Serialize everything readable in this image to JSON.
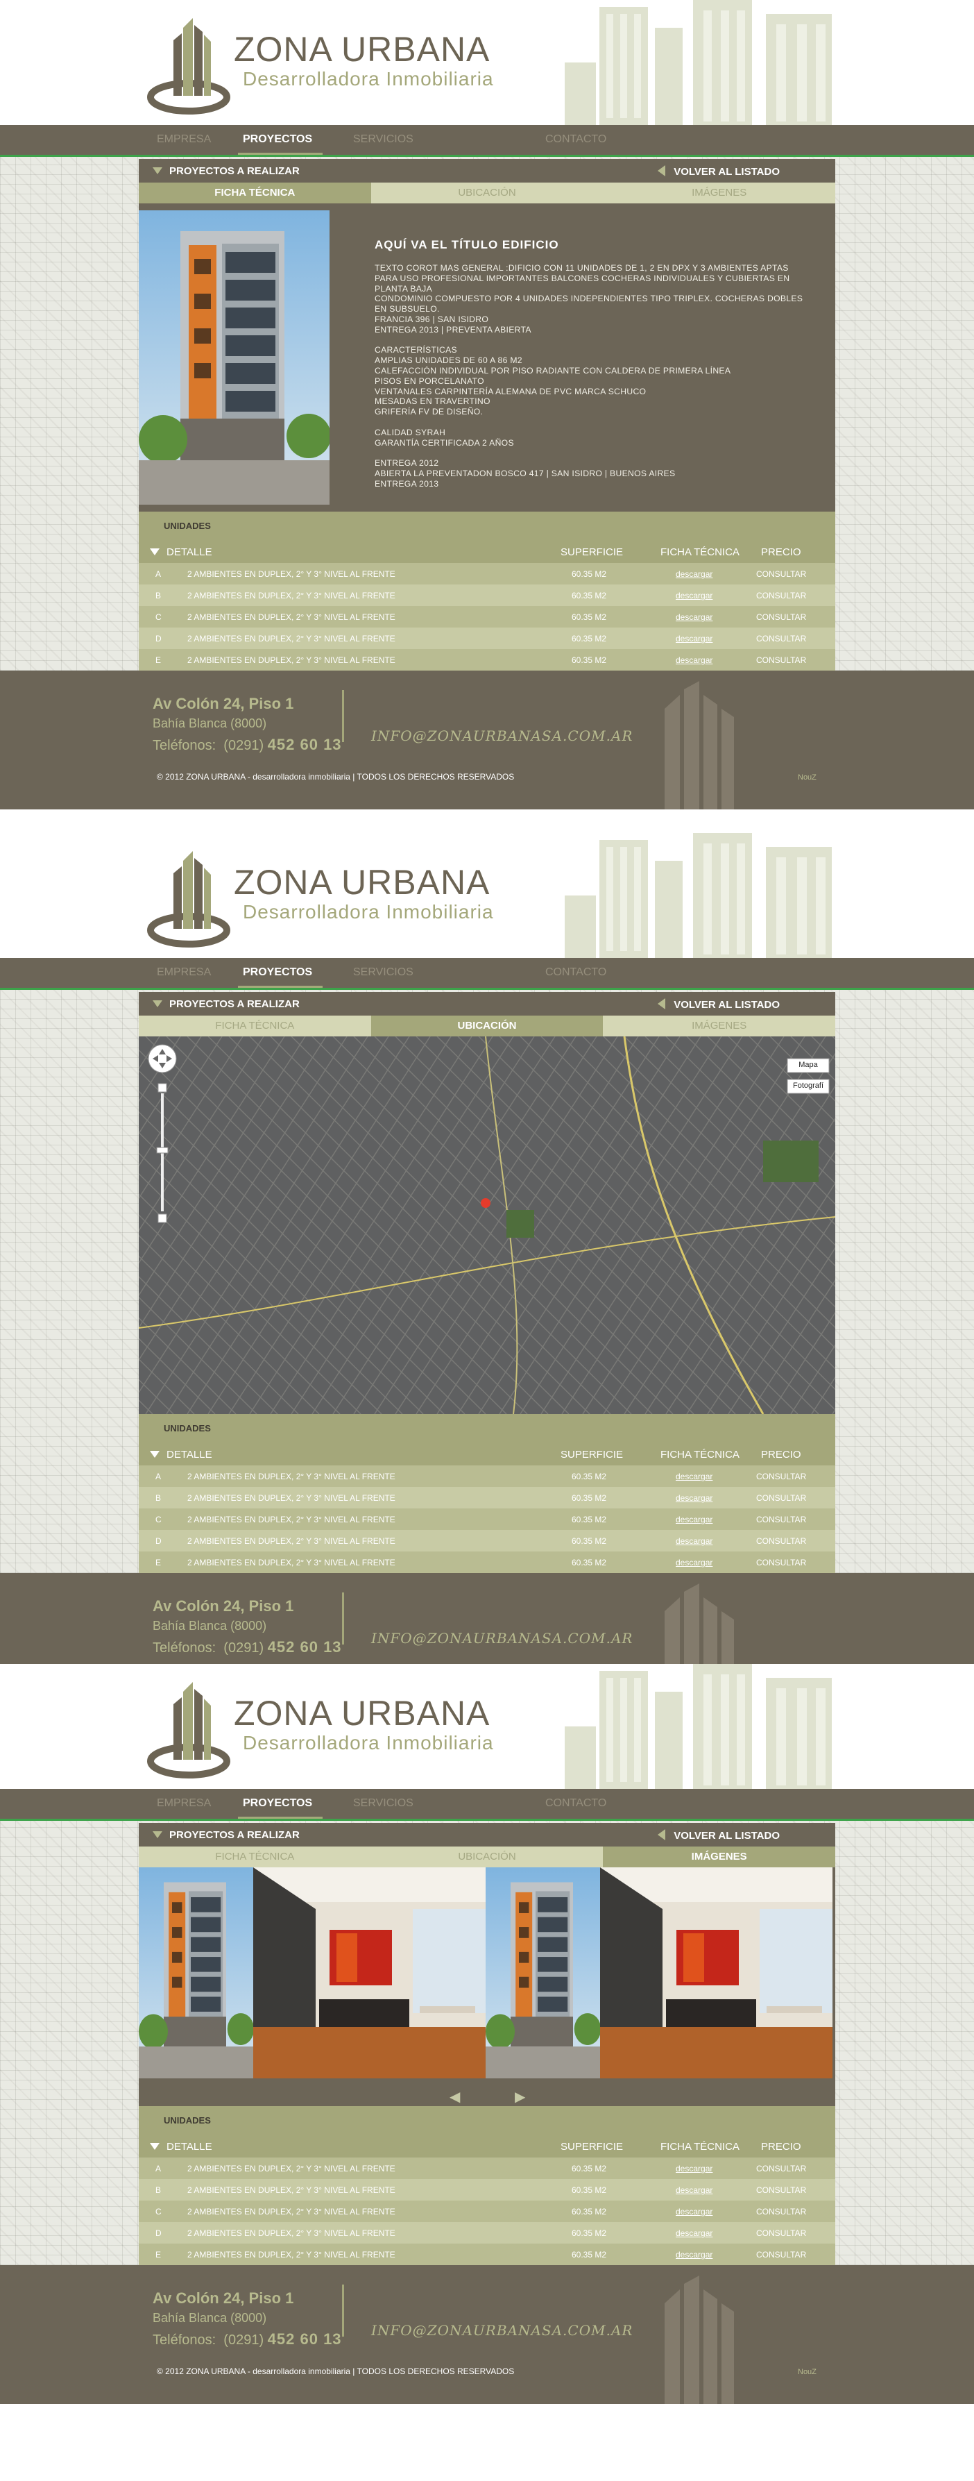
{
  "brand": {
    "name": "ZONA URBANA",
    "subtitle": "Desarrolladora Inmobiliaria"
  },
  "nav": {
    "items": [
      "EMPRESA",
      "PROYECTOS",
      "SERVICIOS",
      "CONTACTO"
    ],
    "active": "PROYECTOS"
  },
  "projects_bar": {
    "left": "PROYECTOS A REALIZAR",
    "right": "VOLVER AL LISTADO"
  },
  "tabs": [
    "FICHA TÉCNICA",
    "UBICACIÓN",
    "IMÁGENES"
  ],
  "ficha": {
    "title": "AQUÍ VA EL TÍTULO EDIFICIO",
    "lines": [
      "TEXTO COROT MAS GENERAL :DIFICIO CON 11 UNIDADES DE 1, 2 EN DPX Y 3 AMBIENTES APTAS",
      "PARA USO PROFESIONAL IMPORTANTES BALCONES COCHERAS INDIVIDUALES Y CUBIERTAS EN",
      "PLANTA BAJA",
      "CONDOMINIO COMPUESTO POR 4 UNIDADES INDEPENDIENTES TIPO TRIPLEX. COCHERAS DOBLES",
      "EN SUBSUELO.",
      "FRANCIA 396 | SAN ISIDRO",
      "ENTREGA 2013 | PREVENTA ABIERTA",
      "",
      "CARACTERÍSTICAS",
      "AMPLIAS UNIDADES DE 60 A 86 M2",
      "CALEFACCIÓN INDIVIDUAL POR PISO RADIANTE CON CALDERA DE PRIMERA LÍNEA",
      "PISOS EN PORCELANATO",
      "VENTANALES CARPINTERÍA ALEMANA DE PVC MARCA SCHUCO",
      "MESADAS EN TRAVERTINO",
      "GRIFERÍA FV DE DISEÑO.",
      "",
      "CALIDAD SYRAH",
      "GARANTÍA CERTIFICADA 2 AÑOS",
      "",
      "ENTREGA 2012",
      "ABIERTA LA PREVENTADON BOSCO 417 | SAN ISIDRO | BUENOS AIRES",
      "ENTREGA 2013"
    ]
  },
  "map": {
    "buttons": [
      "Mapa",
      "Fotografí"
    ]
  },
  "units": {
    "title": "UNIDADES",
    "headers": {
      "detail": "DETALLE",
      "surface": "SUPERFICIE",
      "ficha": "FICHA TÉCNICA",
      "price": "PRECIO"
    },
    "rows": [
      {
        "letter": "A",
        "desc": "2 AMBIENTES EN DUPLEX, 2° Y 3° NIVEL AL FRENTE",
        "surface": "60.35 M2",
        "ficha": "descargar",
        "price": "CONSULTAR"
      },
      {
        "letter": "B",
        "desc": "2 AMBIENTES EN DUPLEX, 2° Y 3° NIVEL AL FRENTE",
        "surface": "60.35 M2",
        "ficha": "descargar",
        "price": "CONSULTAR"
      },
      {
        "letter": "C",
        "desc": "2 AMBIENTES EN DUPLEX, 2° Y 3° NIVEL AL FRENTE",
        "surface": "60.35 M2",
        "ficha": "descargar",
        "price": "CONSULTAR"
      },
      {
        "letter": "D",
        "desc": "2 AMBIENTES EN DUPLEX, 2° Y 3° NIVEL AL FRENTE",
        "surface": "60.35 M2",
        "ficha": "descargar",
        "price": "CONSULTAR"
      },
      {
        "letter": "E",
        "desc": "2 AMBIENTES EN DUPLEX, 2° Y 3° NIVEL AL FRENTE",
        "surface": "60.35 M2",
        "ficha": "descargar",
        "price": "CONSULTAR"
      }
    ]
  },
  "footer": {
    "address": "Av Colón 24, Piso 1",
    "city": "Bahía Blanca (8000)",
    "tel_label": "Teléfonos:",
    "tel_area": "(0291)",
    "tel_number": "452 60 13",
    "email": "INFO@ZONAURBANASA.COM.AR",
    "copyright": "© 2012 ZONA URBANA - desarrolladora inmobiliaria | TODOS LOS DERECHOS RESERVADOS",
    "credit": "NouZ"
  },
  "colors": {
    "brown": "#6c6557",
    "olive": "#a4a77a",
    "olive_light": "#d5d7b5",
    "green_line": "#3da34a",
    "accent_orange": "#d9782b"
  }
}
